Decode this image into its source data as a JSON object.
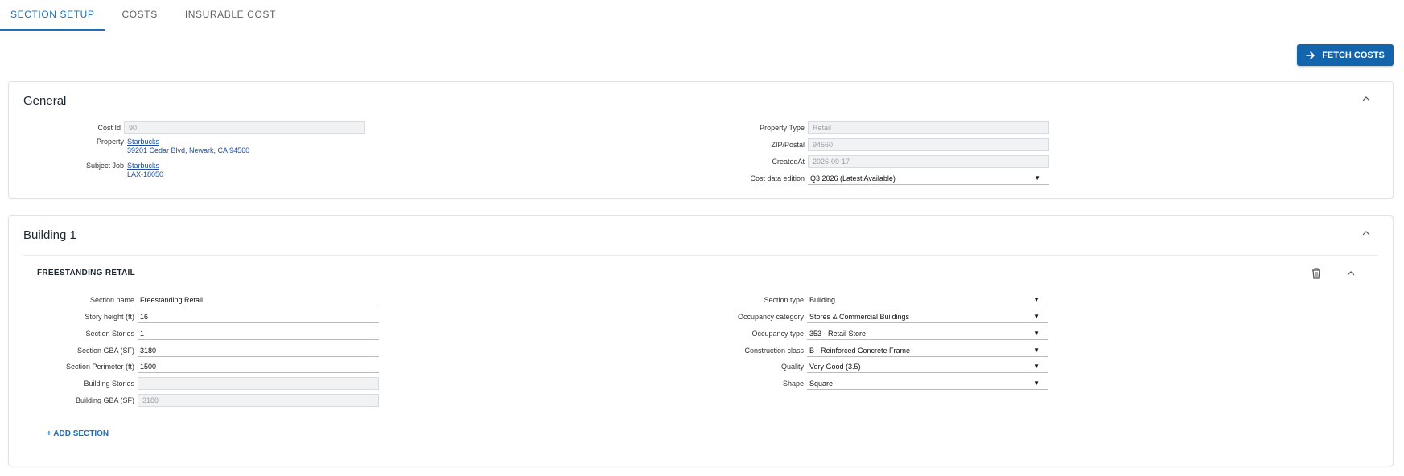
{
  "tabs": [
    {
      "label": "SECTION SETUP",
      "active": true
    },
    {
      "label": "COSTS",
      "active": false
    },
    {
      "label": "INSURABLE COST",
      "active": false
    }
  ],
  "toolbar": {
    "fetch_label": "FETCH COSTS",
    "fetch_icon": "arrow-right-icon"
  },
  "general": {
    "title": "General",
    "cost_id": {
      "label": "Cost Id",
      "value": "90"
    },
    "property": {
      "label": "Property",
      "name": "Starbucks",
      "address": "39201 Cedar Blvd, Newark, CA 94560"
    },
    "subject_job": {
      "label": "Subject Job",
      "name": "Starbucks",
      "job": "LAX-18050"
    },
    "property_type": {
      "label": "Property Type",
      "value": "Retail"
    },
    "zip": {
      "label": "ZIP/Postal",
      "value": "94560"
    },
    "created_at": {
      "label": "CreatedAt",
      "value": "2026-09-17"
    },
    "edition": {
      "label": "Cost data edition",
      "value": "Q3 2026 (Latest Available)"
    }
  },
  "building": {
    "title": "Building 1",
    "section": {
      "title": "FREESTANDING RETAIL",
      "left": [
        {
          "label": "Section name",
          "value": "Freestanding Retail",
          "disabled": false
        },
        {
          "label": "Story height (ft)",
          "value": "16",
          "disabled": false
        },
        {
          "label": "Section Stories",
          "value": "1",
          "disabled": false
        },
        {
          "label": "Section GBA (SF)",
          "value": "3180",
          "disabled": false
        },
        {
          "label": "Section Perimeter (ft)",
          "value": "1500",
          "disabled": false
        },
        {
          "label": "Building Stories",
          "value": "",
          "disabled": true
        },
        {
          "label": "Building GBA (SF)",
          "value": "3180",
          "disabled": true
        }
      ],
      "right": [
        {
          "label": "Section type",
          "value": "Building"
        },
        {
          "label": "Occupancy category",
          "value": "Stores & Commercial Buildings"
        },
        {
          "label": "Occupancy type",
          "value": "353 - Retail Store"
        },
        {
          "label": "Construction class",
          "value": "B - Reinforced Concrete Frame"
        },
        {
          "label": "Quality",
          "value": "Very Good (3.5)"
        },
        {
          "label": "Shape",
          "value": "Square"
        }
      ]
    },
    "add_section_label": "+ ADD SECTION"
  },
  "colors": {
    "accent": "#1f6fb5",
    "button": "#1264ad",
    "link": "#1a4fa0"
  }
}
